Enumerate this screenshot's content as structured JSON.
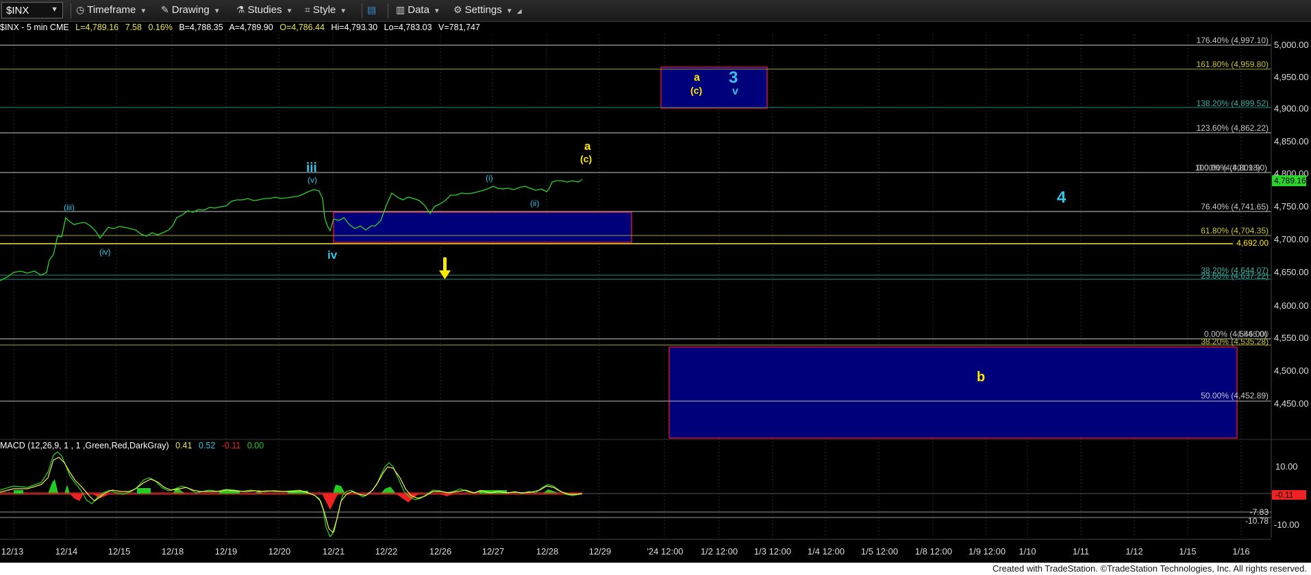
{
  "toolbar": {
    "symbol": "$INX",
    "timeframe_label": "Timeframe",
    "drawing_label": "Drawing",
    "studies_label": "Studies",
    "style_label": "Style",
    "data_label": "Data",
    "settings_label": "Settings"
  },
  "infobar": {
    "symbol_desc": "$INX - 5 min  CME",
    "last": "L=4,789.16",
    "change": "7.58",
    "pct": "0.16%",
    "bid": "B=4,788.35",
    "ask": "A=4,789.90",
    "open": "O=4,786.44",
    "high": "Hi=4,793.30",
    "low": "Lo=4,783.03",
    "volume": "V=781,747"
  },
  "macd_legend": {
    "name": "MACD (12,26,9, 1 , 1 ,Green,Red,DarkGray)",
    "v1": "0.41",
    "v2": "0.52",
    "v3": "-0.11",
    "v4": "0.00"
  },
  "colors": {
    "background": "#000000",
    "price": "#2bd42b",
    "wave_cyan": "#33c5e6",
    "wave_yellow": "#ffe800",
    "box_fill": "#00007a",
    "box_border": "#cc1133",
    "fib_text": "#c8c8c8"
  },
  "price_axis": {
    "ticks": [
      "5,000.00",
      "4,950.00",
      "4,900.00",
      "4,850.00",
      "4,800.00",
      "4,750.00",
      "4,700.00",
      "4,650.00",
      "4,600.00",
      "4,550.00",
      "4,500.00",
      "4,450.00"
    ],
    "current_price": "4,789.16",
    "line_price": "4,692.00"
  },
  "macd_axis": {
    "ticks": [
      "10.00",
      "-10.00"
    ],
    "current": "-0.11",
    "level1": "-7.83",
    "level2": "-10.78"
  },
  "date_axis": [
    "12/13",
    "12/14",
    "12/15",
    "12/18",
    "12/19",
    "12/20",
    "12/21",
    "12/22",
    "12/26",
    "12/27",
    "12/28",
    "12/29",
    "'24 12:00",
    "1/2 12:00",
    "1/3 12:00",
    "1/4 12:00",
    "1/5 12:00",
    "1/8 12:00",
    "1/9 12:00",
    "1/10",
    "1/11",
    "1/12",
    "1/15",
    "1/16"
  ],
  "fib_labels": [
    {
      "text": "176.40% (4,997.10)",
      "color": "#c8c8c8"
    },
    {
      "text": "161.80% (4,959.80)",
      "color": "#c8c832"
    },
    {
      "text": "138.20% (4,899.52)",
      "color": "#3ab0a0"
    },
    {
      "text": "123.60% (4,862.22)",
      "color": "#c8c8c8"
    },
    {
      "text": "100.00% (4,801.90)",
      "color": "#c8c8c8"
    },
    {
      "text": "0.00% (4,801.98)",
      "color": "#c8c8c8"
    },
    {
      "text": "76.40% (4,741.65)",
      "color": "#c8c8c8"
    },
    {
      "text": "61.80% (4,704.35)",
      "color": "#c8c832"
    },
    {
      "text": "38.20% (4,644.07)",
      "color": "#3ab0a0"
    },
    {
      "text": "23.60% (4,637.22)",
      "color": "#3ab0a0"
    },
    {
      "text": "0.00% (4,546.00)",
      "color": "#c8c8c8"
    },
    {
      "text": "4,546.00",
      "color": "#c8c8c8"
    },
    {
      "text": "38.20% (4,535.28)",
      "color": "#c8c832"
    },
    {
      "text": "50.00% (4,452.89)",
      "color": "#c8c8c8"
    }
  ],
  "wave_labels": {
    "iii_big": "iii",
    "v_small": "(v)",
    "iii_small": "(iii)",
    "iv_small": "(iv)",
    "iv_big": "iv",
    "i_small": "(i)",
    "ii_small": "(ii)",
    "a_top": "a",
    "c_top": "(c)",
    "a_box": "a",
    "c_box": "(c)",
    "three": "3",
    "v_box": "v",
    "four": "4",
    "b": "b"
  },
  "footer": {
    "credit": "Created with TradeStation. ©TradeStation Technologies, Inc. All rights reserved."
  }
}
